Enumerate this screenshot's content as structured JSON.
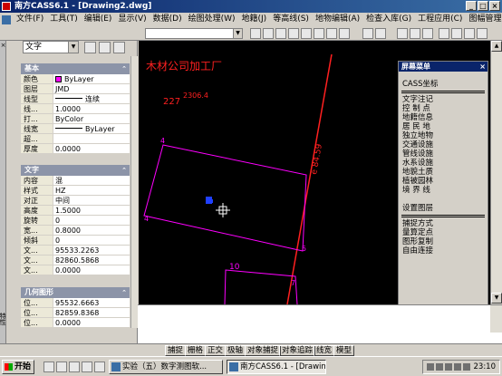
{
  "window": {
    "title": "南方CASS6.1 - [Drawing2.dwg]",
    "buttons": [
      "_",
      "□",
      "×"
    ]
  },
  "menubar": {
    "items": [
      "文件(F)",
      "工具(T)",
      "编辑(E)",
      "显示(V)",
      "数据(D)",
      "绘图处理(W)",
      "地籍(J)",
      "等高线(S)",
      "地物编辑(A)",
      "检查入库(G)",
      "工程应用(C)",
      "图幅管理(M)"
    ]
  },
  "palette": {
    "object_type": "文字",
    "basic": {
      "header": "基本",
      "rows": [
        {
          "k": "颜色",
          "v": "ByLayer"
        },
        {
          "k": "图层",
          "v": "JMD"
        },
        {
          "k": "线型",
          "v": "连续"
        },
        {
          "k": "线...",
          "v": "1.0000"
        },
        {
          "k": "打...",
          "v": "ByColor"
        },
        {
          "k": "线宽",
          "v": "ByLayer"
        },
        {
          "k": "超...",
          "v": ""
        },
        {
          "k": "厚度",
          "v": "0.0000"
        }
      ]
    },
    "text": {
      "header": "文字",
      "rows": [
        {
          "k": "内容",
          "v": "混"
        },
        {
          "k": "样式",
          "v": "HZ"
        },
        {
          "k": "对正",
          "v": "中间"
        },
        {
          "k": "高度",
          "v": "1.5000"
        },
        {
          "k": "旋转",
          "v": "0"
        },
        {
          "k": "宽...",
          "v": "0.8000"
        },
        {
          "k": "倾斜",
          "v": "0"
        },
        {
          "k": "文...",
          "v": "95533.2263"
        },
        {
          "k": "文...",
          "v": "82860.5868"
        },
        {
          "k": "文...",
          "v": "0.0000"
        }
      ]
    },
    "geometry": {
      "header": "几何图形",
      "rows": [
        {
          "k": "位...",
          "v": "95532.6663"
        },
        {
          "k": "位...",
          "v": "82859.8368"
        },
        {
          "k": "位...",
          "v": "0.0000"
        }
      ]
    },
    "side_label": "特性"
  },
  "canvas": {
    "factory_label": "木材公司加工厂",
    "elev_label_a": "227",
    "elev_label_b": "2306.4",
    "vertex_4": "4",
    "vertex_5": "5",
    "vertex_7": "7",
    "parcel_10": "10",
    "road_label": "e 84.59"
  },
  "screen_menu": {
    "title": "屏幕菜单",
    "top": "CASS坐标",
    "items": [
      "文字注记",
      "控 制 点",
      "地籍信息",
      "居 民 地",
      "独立地物",
      "交通设施",
      "管线设施",
      "水系设施",
      "地貌土质",
      "植被园林",
      "境 界 线"
    ],
    "items2": [
      "设置图层"
    ],
    "items3": [
      "捕捉方式",
      "量算定点",
      "图形复制",
      "自由连接"
    ]
  },
  "statusbar": {
    "coords": "",
    "buttons": [
      "捕捉",
      "栅格",
      "正交",
      "极轴",
      "对象捕捉",
      "对象追踪",
      "线宽",
      "模型"
    ]
  },
  "taskbar": {
    "start": "开始",
    "tasks": [
      "实验（五）数字测图软...",
      "南方CASS6.1 - [Drawing..."
    ],
    "clock": "23:10"
  },
  "colors": {
    "title_bg": "#0a246a",
    "canvas_bg": "#000000",
    "magenta": "#ff00ff",
    "red_line": "#ff2020"
  }
}
